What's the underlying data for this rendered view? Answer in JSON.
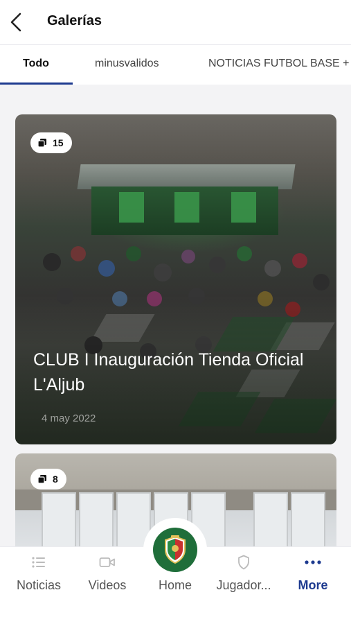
{
  "header": {
    "title": "Galerías"
  },
  "tabs": [
    {
      "label": "Todo",
      "active": true
    },
    {
      "label": "minusvalidos",
      "active": false
    },
    {
      "label": "NOTICIAS FUTBOL BASE + FI",
      "active": false
    }
  ],
  "galleries": [
    {
      "count": "15",
      "title": "CLUB I Inauguración Tienda Oficial L'Aljub",
      "date": "4 may 2022"
    },
    {
      "count": "8"
    }
  ],
  "nav": {
    "items": [
      {
        "label": "Noticias",
        "icon": "list-icon"
      },
      {
        "label": "Videos",
        "icon": "video-camera-icon"
      },
      {
        "label": "Home",
        "icon": "club-crest-icon"
      },
      {
        "label": "Jugador...",
        "icon": "shield-icon"
      },
      {
        "label": "More",
        "icon": "more-dots-icon",
        "active": true
      }
    ]
  },
  "colors": {
    "accent": "#1d3a8f",
    "club_green": "#1f6e3a"
  }
}
